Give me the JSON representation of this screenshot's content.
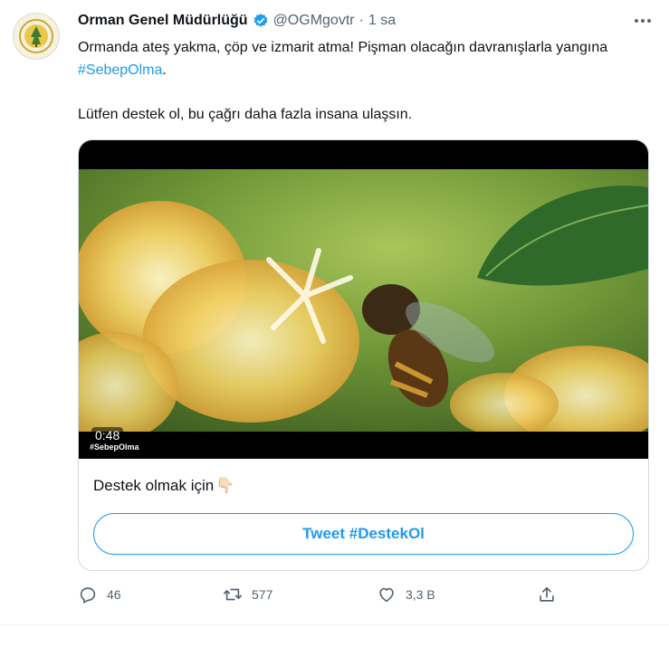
{
  "tweet": {
    "author_name": "Orman Genel Müdürlüğü",
    "handle": "@OGMgovtr",
    "separator": "·",
    "time": "1 sa",
    "text_line1_prefix": "Ormanda ateş yakma, çöp ve izmarit atma! Pişman olacağın davranışlarla yangına ",
    "hashtag": "#SebepOlma",
    "text_line1_suffix": ".",
    "text_line2": "Lütfen destek ol, bu çağrı daha fazla insana ulaşsın."
  },
  "video": {
    "duration": "0:48",
    "caption": "#SebepOlma"
  },
  "card": {
    "text": "Destek olmak için",
    "emoji": "👇🏻",
    "button_label": "Tweet #DestekOl"
  },
  "actions": {
    "replies": "46",
    "retweets": "577",
    "likes": "3,3 B"
  },
  "colors": {
    "accent": "#1d9bf0",
    "muted": "#536471",
    "border": "#cfd9de"
  },
  "icons": [
    "verified-badge-icon",
    "more-icon",
    "reply-icon",
    "retweet-icon",
    "like-icon",
    "share-icon"
  ]
}
